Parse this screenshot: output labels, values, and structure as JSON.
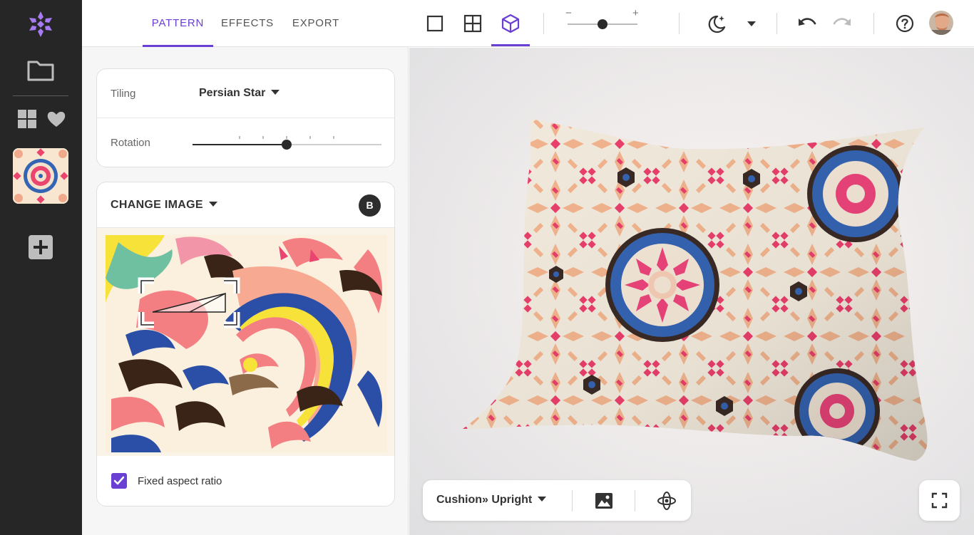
{
  "tabs": [
    {
      "label": "PATTERN",
      "active": true
    },
    {
      "label": "EFFECTS",
      "active": false
    },
    {
      "label": "EXPORT",
      "active": false
    }
  ],
  "tiling": {
    "label": "Tiling",
    "value": "Persian Star"
  },
  "rotation": {
    "label": "Rotation",
    "value_fraction": 0.5
  },
  "change_image": {
    "title": "CHANGE IMAGE",
    "badge": "B"
  },
  "aspect": {
    "label": "Fixed aspect ratio",
    "checked": true
  },
  "toolbar": {
    "views": [
      "single-tile-icon",
      "grid-tile-icon",
      "3d-cube-icon"
    ],
    "active_view": "3d-cube-icon",
    "zoom_minus": "−",
    "zoom_plus": "+",
    "zoom_fraction": 0.5
  },
  "viewport": {
    "model_label": "Cushion» Upright"
  },
  "colors": {
    "accent": "#6a3fd4",
    "rail": "#262626",
    "logo": "#a77bf3"
  }
}
